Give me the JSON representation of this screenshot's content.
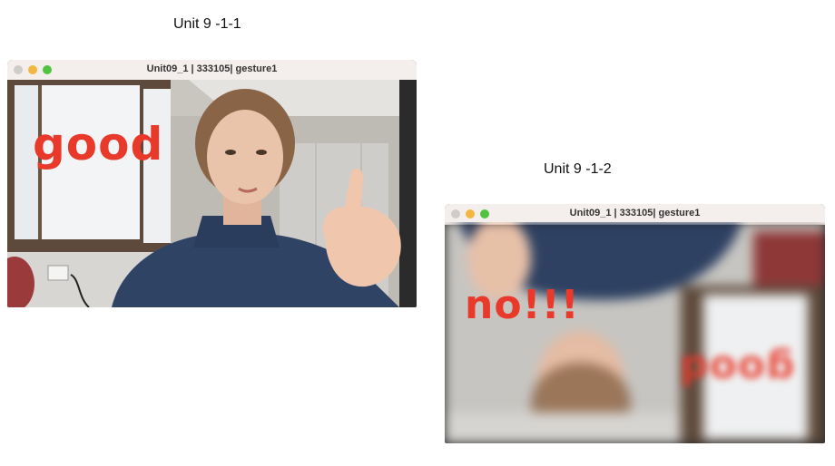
{
  "captions": {
    "left": "Unit 9 -1-1",
    "right": "Unit 9 -1-2"
  },
  "window_left": {
    "title": "Unit09_1 | 333105| gesture1",
    "overlay_text": "good"
  },
  "window_right": {
    "title": "Unit09_1 | 333105| gesture1",
    "overlay_text": "no!!!",
    "overlay_text_mirrored": "good"
  },
  "colors": {
    "overlay_red": "#e8392a",
    "titlebar": "#f4efec"
  }
}
